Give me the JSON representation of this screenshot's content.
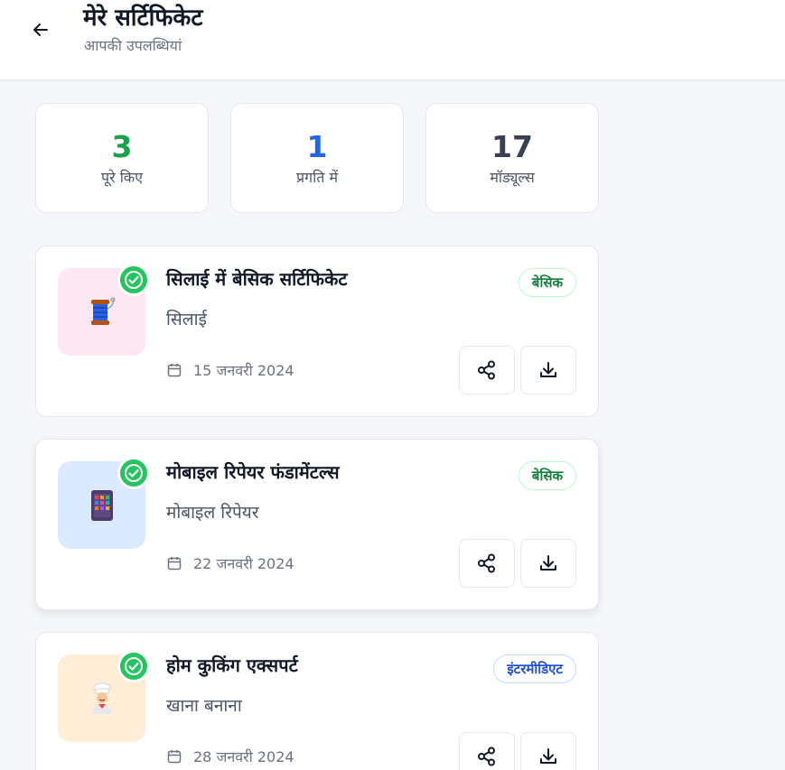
{
  "header": {
    "title": "मेरे सर्टिफिकेट",
    "subtitle": "आपकी उपलब्धियां",
    "back_icon": "arrow-left-icon"
  },
  "stats": [
    {
      "value": "3",
      "label": "पूरे किए",
      "color": "#16a34a"
    },
    {
      "value": "1",
      "label": "प्रगति में",
      "color": "#2563eb"
    },
    {
      "value": "17",
      "label": "मॉड्यूल्स",
      "color": "#374151"
    }
  ],
  "certificates": [
    {
      "title": "सिलाई में बेसिक सर्टिफिकेट",
      "category": "सिलाई",
      "date": "15 जनवरी 2024",
      "level": "बेसिक",
      "icon": "thread-spool-icon",
      "thumb_bg": "#fce7f3"
    },
    {
      "title": "मोबाइल रिपेयर फंडामेंटल्स",
      "category": "मोबाइल रिपेयर",
      "date": "22 जनवरी 2024",
      "level": "बेसिक",
      "icon": "mobile-phone-icon",
      "thumb_bg": "#dbeafe"
    },
    {
      "title": "होम कुकिंग एक्सपर्ट",
      "category": "खाना बनाना",
      "date": "28 जनवरी 2024",
      "level": "इंटरमीडिएट",
      "icon": "cook-icon",
      "thumb_bg": "#ffedd5"
    }
  ],
  "colors": {
    "success": "#22c55e",
    "basic_badge": "#15803d",
    "intermediate_badge": "#1d4ed8"
  }
}
